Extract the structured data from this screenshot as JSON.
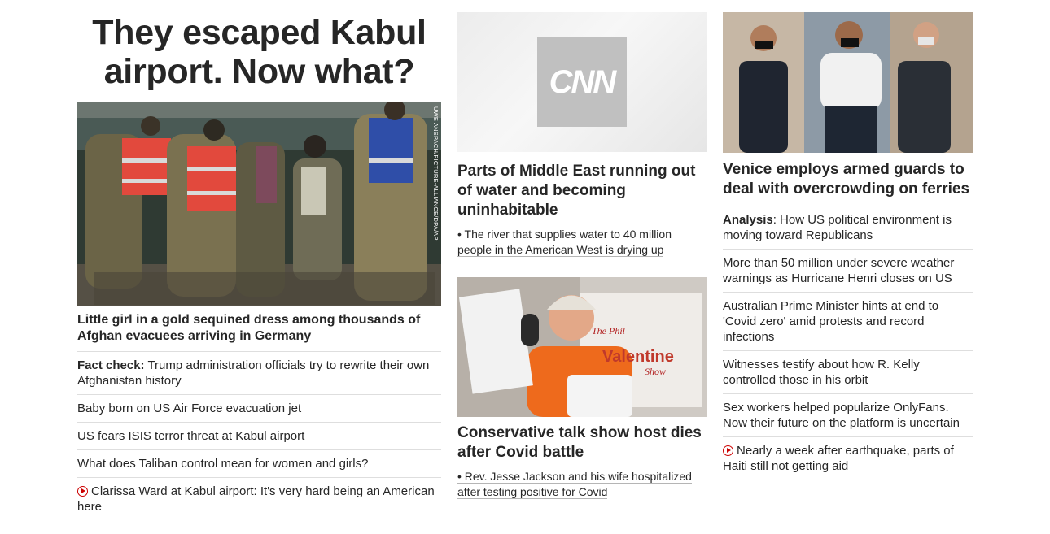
{
  "left": {
    "headline": "They escaped Kabul airport. Now what?",
    "photo_credit": "UWE ANSPACH/PICTURE-ALLIANCE/DPA/AP",
    "lead_story": "Little girl in a gold sequined dress among thousands of Afghan evacuees arriving in Germany",
    "items": [
      {
        "prefix": "Fact check:",
        "text": " Trump administration officials try to rewrite their own Afghanistan history"
      },
      {
        "prefix": "",
        "text": "Baby born on US Air Force evacuation jet"
      },
      {
        "prefix": "",
        "text": "US fears ISIS terror threat at Kabul airport"
      },
      {
        "prefix": "",
        "text": "What does Taliban control mean for women and girls?"
      },
      {
        "prefix": "",
        "text": "Clarissa Ward at Kabul airport: It's very hard being an American here",
        "icon": "play-icon"
      }
    ]
  },
  "middle": {
    "story1": {
      "logo": "CNN",
      "title": "Parts of Middle East running out of water and becoming uninhabitable",
      "related": "• The river that supplies water to 40 million people in the American West is drying up"
    },
    "story2": {
      "banner_text": "The Phil Valentine Show",
      "title": "Conservative talk show host dies after Covid battle",
      "related": "• Rev. Jesse Jackson and his wife hospitalized after testing positive for Covid"
    }
  },
  "right": {
    "title": "Venice employs armed guards to deal with overcrowding on ferries",
    "items": [
      {
        "prefix": "Analysis",
        "text": ": How US political environment is moving toward Republicans"
      },
      {
        "prefix": "",
        "text": "More than 50 million under severe weather warnings as Hurricane Henri closes on US"
      },
      {
        "prefix": "",
        "text": "Australian Prime Minister hints at end to 'Covid zero' amid protests and record infections"
      },
      {
        "prefix": "",
        "text": "Witnesses testify about how R. Kelly controlled those in his orbit"
      },
      {
        "prefix": "",
        "text": "Sex workers helped popularize OnlyFans. Now their future on the platform is uncertain"
      },
      {
        "prefix": "",
        "text": "Nearly a week after earthquake, parts of Haiti still not getting aid",
        "icon": "play-icon"
      }
    ]
  },
  "colors": {
    "text": "#262626",
    "divider": "#dedede",
    "video_icon": "#cc0000",
    "logo_box": "#c0c0c0"
  }
}
